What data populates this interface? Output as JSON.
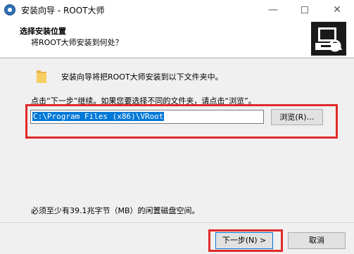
{
  "window": {
    "title": "安装向导 - ROOT大师",
    "minimize_label": "—",
    "close_label": "✕"
  },
  "header": {
    "title": "选择安装位置",
    "subtitle": "将ROOT大师安装到何处？"
  },
  "main": {
    "intro": "安装向导将把ROOT大师安装到以下文件夹中。",
    "instruction": "点击“下一步”继续。如果您要选择不同的文件夹，请点击“浏览”。",
    "path_value": "C:\\Program Files (x86)\\VRoot",
    "browse_label": "浏览(R)…",
    "space_required": "必须至少有39.1兆字节（MB）的闲置磁盘空间。"
  },
  "footer": {
    "next_label": "下一步(N) >",
    "cancel_label": "取消"
  },
  "colors": {
    "highlight": "#e22a2a",
    "selection": "#0078d7"
  }
}
